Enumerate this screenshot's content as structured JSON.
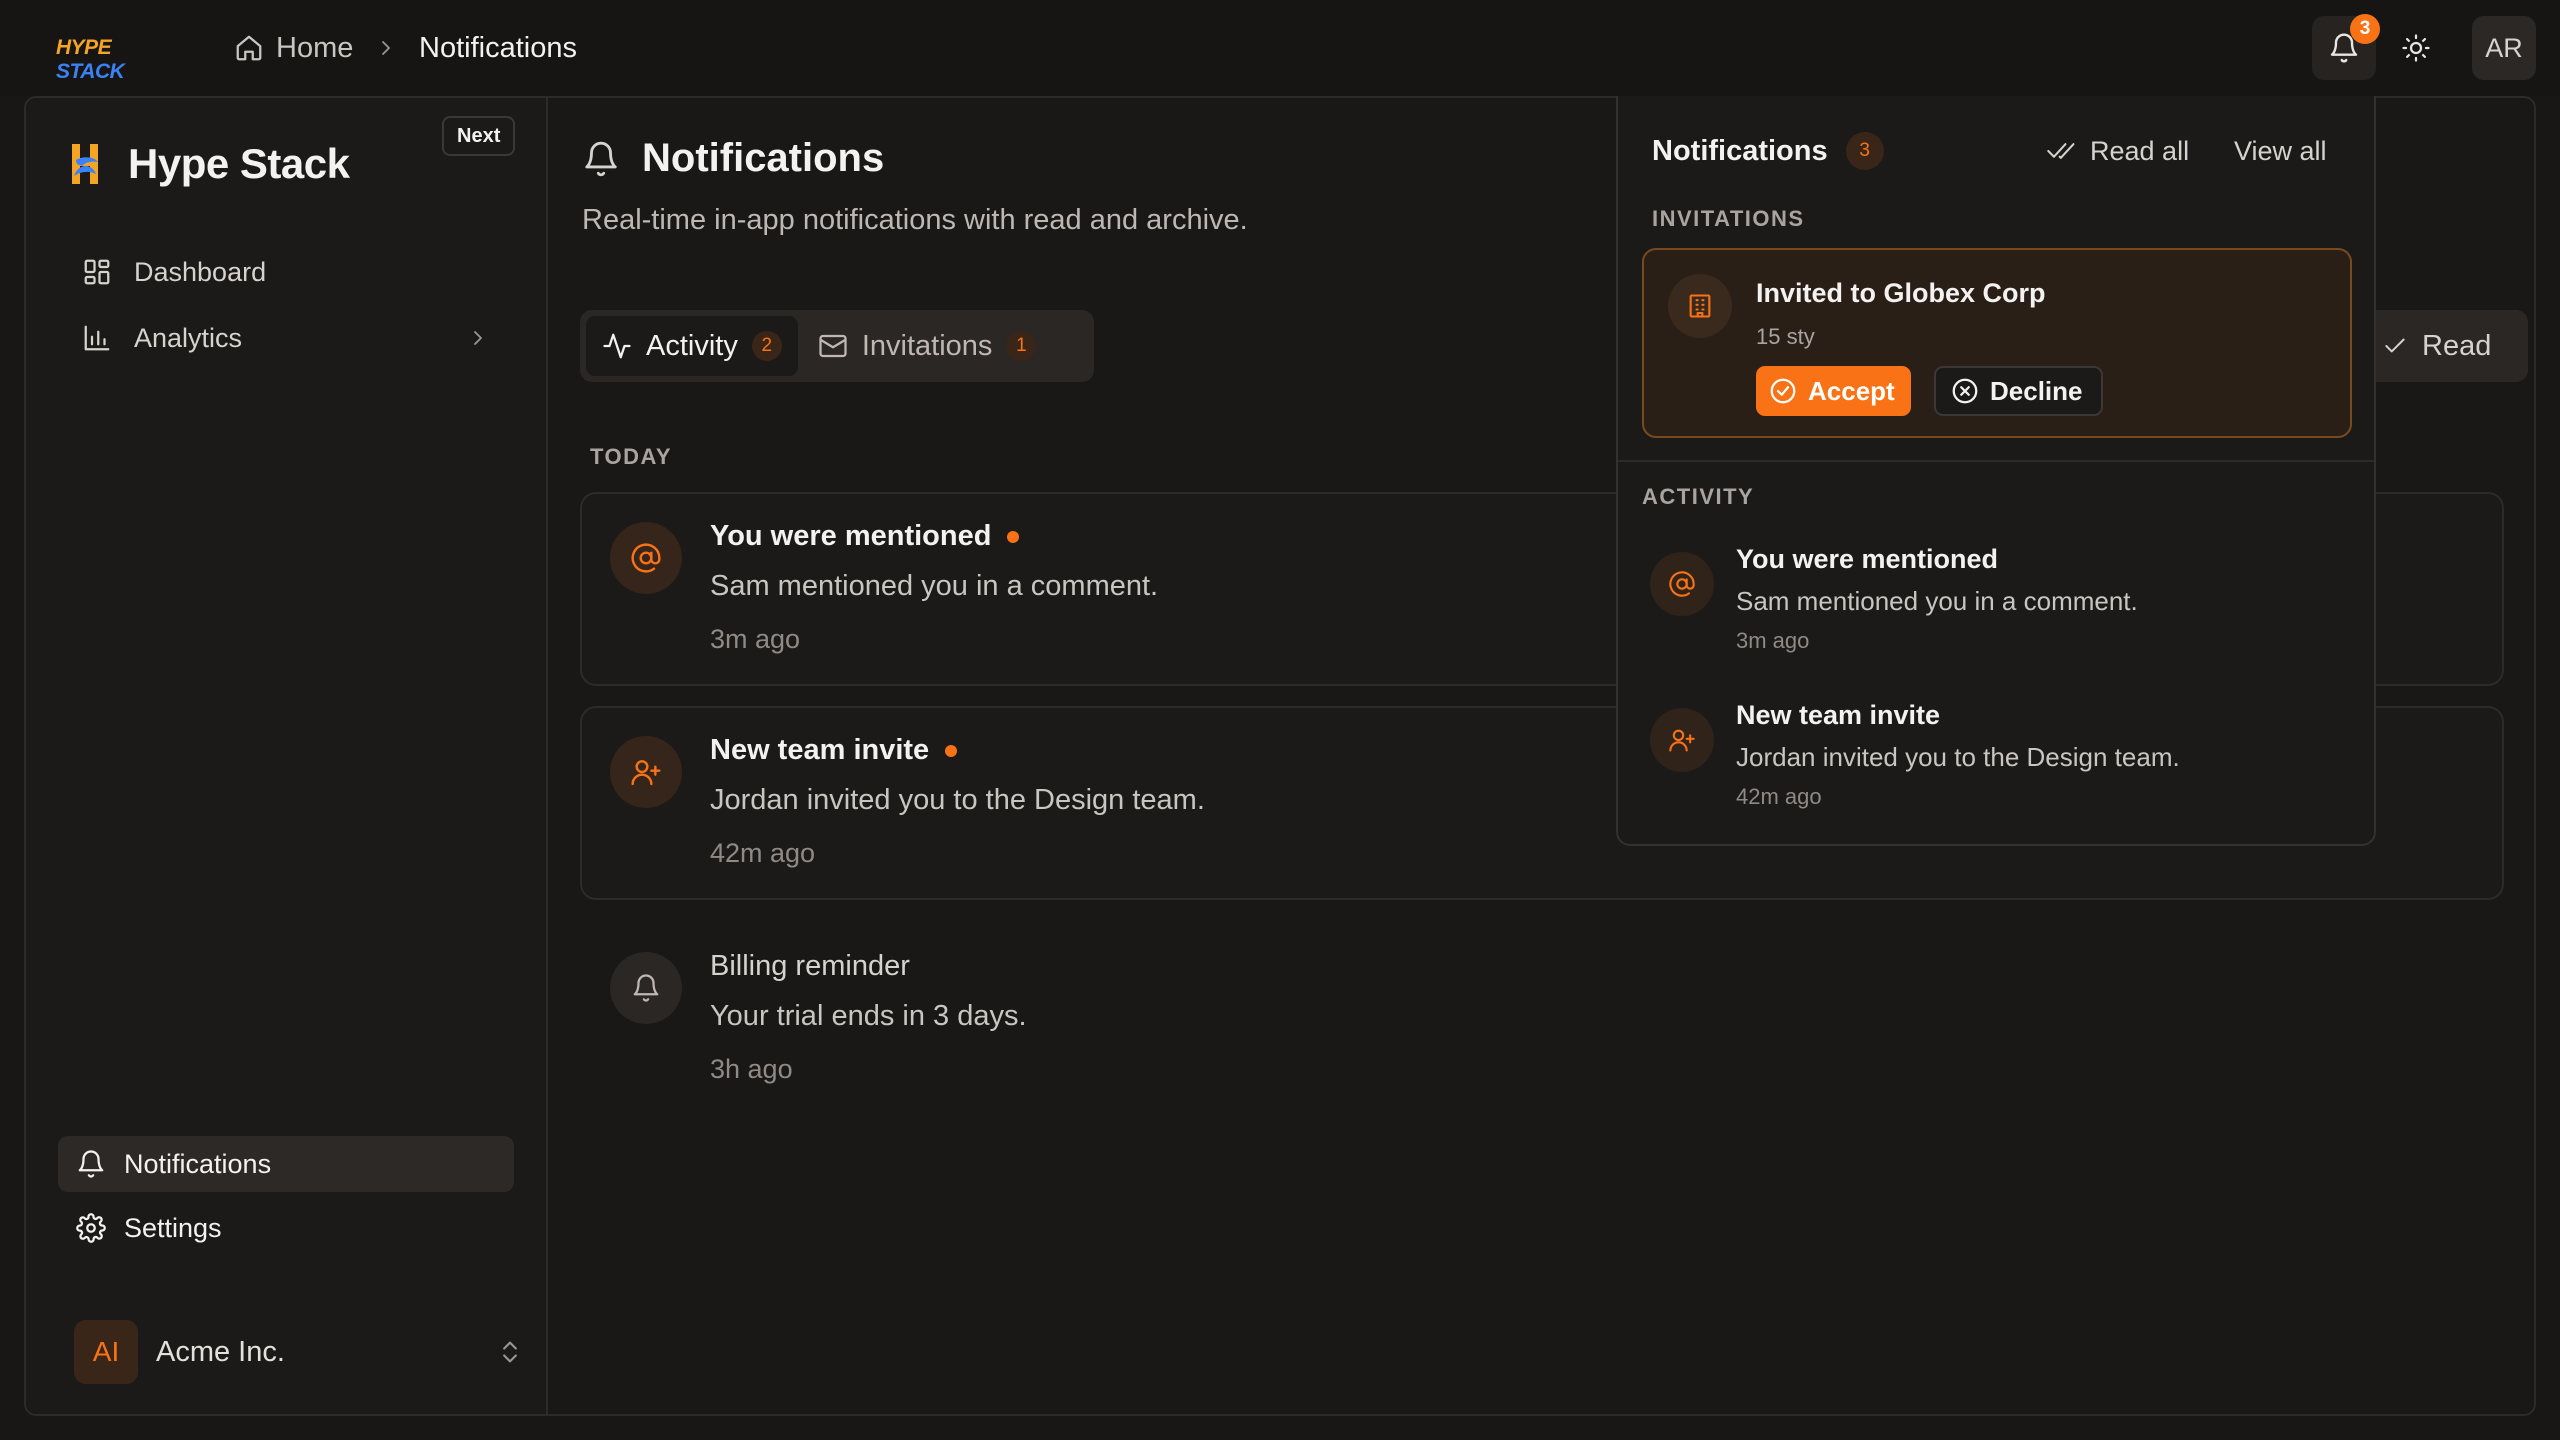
{
  "app": {
    "logo_word_1": "HYPE",
    "logo_word_2": "STACK",
    "brand_name": "Hype Stack",
    "next_badge": "Next",
    "avatar_initials": "AR",
    "bell_count": "3",
    "colors": {
      "accent": "#f97316",
      "background": "#181716",
      "panel": "#1c1a19"
    }
  },
  "breadcrumb": {
    "home": "Home",
    "current": "Notifications"
  },
  "sidebar": {
    "items": [
      {
        "label": "Dashboard",
        "icon": "grid-icon"
      },
      {
        "label": "Analytics",
        "icon": "bar-chart-icon"
      }
    ],
    "bottom_items": [
      {
        "label": "Notifications",
        "icon": "bell-icon",
        "active": true
      },
      {
        "label": "Settings",
        "icon": "gear-icon"
      }
    ],
    "org": {
      "initials": "AI",
      "name": "Acme Inc."
    }
  },
  "main": {
    "title": "Notifications",
    "description": "Real-time in-app notifications with read and archive.",
    "tabs": [
      {
        "label": "Activity",
        "count": "2",
        "icon": "activity-icon",
        "active": true
      },
      {
        "label": "Invitations",
        "count": "1",
        "icon": "mail-icon"
      }
    ],
    "read_button": "Read",
    "section_label": "TODAY",
    "notifications": [
      {
        "title": "You were mentioned",
        "body": "Sam mentioned you in a comment.",
        "time": "3m ago",
        "icon": "at-sign-icon",
        "unread": true
      },
      {
        "title": "New team invite",
        "body": "Jordan invited you to the Design team.",
        "time": "42m ago",
        "icon": "user-plus-icon",
        "unread": true
      },
      {
        "title": "Billing reminder",
        "body": "Your trial ends in 3 days.",
        "time": "3h ago",
        "icon": "bell-icon",
        "unread": false
      }
    ]
  },
  "popover": {
    "title": "Notifications",
    "count": "3",
    "read_all": "Read all",
    "view_all": "View all",
    "invitations_label": "INVITATIONS",
    "invitation": {
      "title": "Invited to Globex Corp",
      "meta": "15 sty",
      "accept": "Accept",
      "decline": "Decline"
    },
    "activity_label": "ACTIVITY",
    "items": [
      {
        "title": "You were mentioned",
        "body": "Sam mentioned you in a comment.",
        "time": "3m ago"
      },
      {
        "title": "New team invite",
        "body": "Jordan invited you to the Design team.",
        "time": "42m ago"
      }
    ]
  }
}
